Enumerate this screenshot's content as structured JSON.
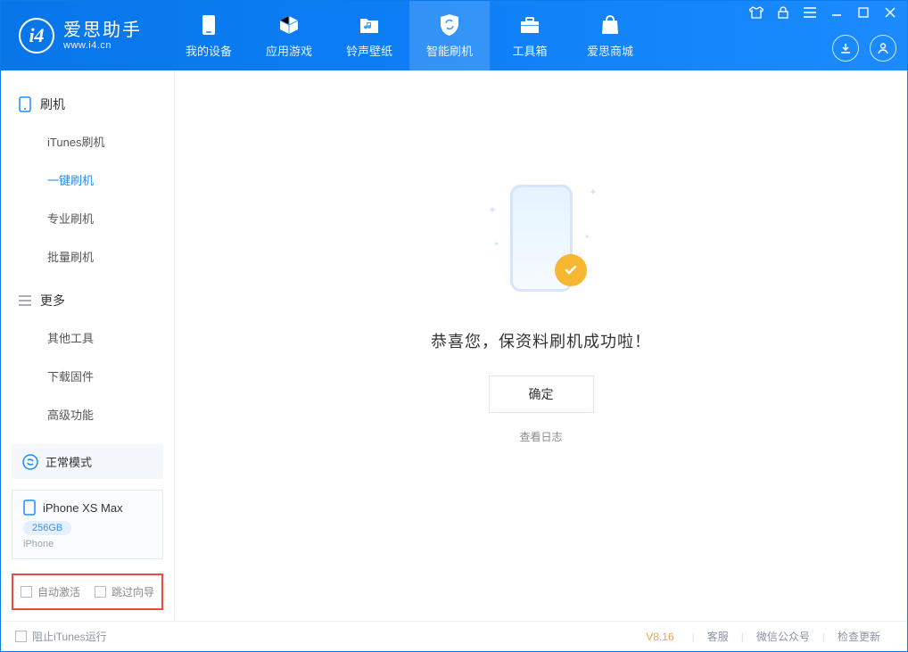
{
  "app": {
    "name": "爱思助手",
    "domain": "www.i4.cn"
  },
  "tabs": [
    {
      "label": "我的设备"
    },
    {
      "label": "应用游戏"
    },
    {
      "label": "铃声壁纸"
    },
    {
      "label": "智能刷机"
    },
    {
      "label": "工具箱"
    },
    {
      "label": "爱思商城"
    }
  ],
  "sidebar": {
    "group1": {
      "title": "刷机",
      "items": [
        "iTunes刷机",
        "一键刷机",
        "专业刷机",
        "批量刷机"
      ]
    },
    "group2": {
      "title": "更多",
      "items": [
        "其他工具",
        "下载固件",
        "高级功能"
      ]
    },
    "mode": "正常模式",
    "device": {
      "name": "iPhone XS Max",
      "storage": "256GB",
      "type": "iPhone"
    },
    "opts": {
      "auto_activate": "自动激活",
      "skip_guide": "跳过向导"
    }
  },
  "main": {
    "message": "恭喜您，保资料刷机成功啦！",
    "ok": "确定",
    "view_log": "查看日志"
  },
  "footer": {
    "block_itunes": "阻止iTunes运行",
    "version": "V8.16",
    "links": [
      "客服",
      "微信公众号",
      "检查更新"
    ]
  }
}
